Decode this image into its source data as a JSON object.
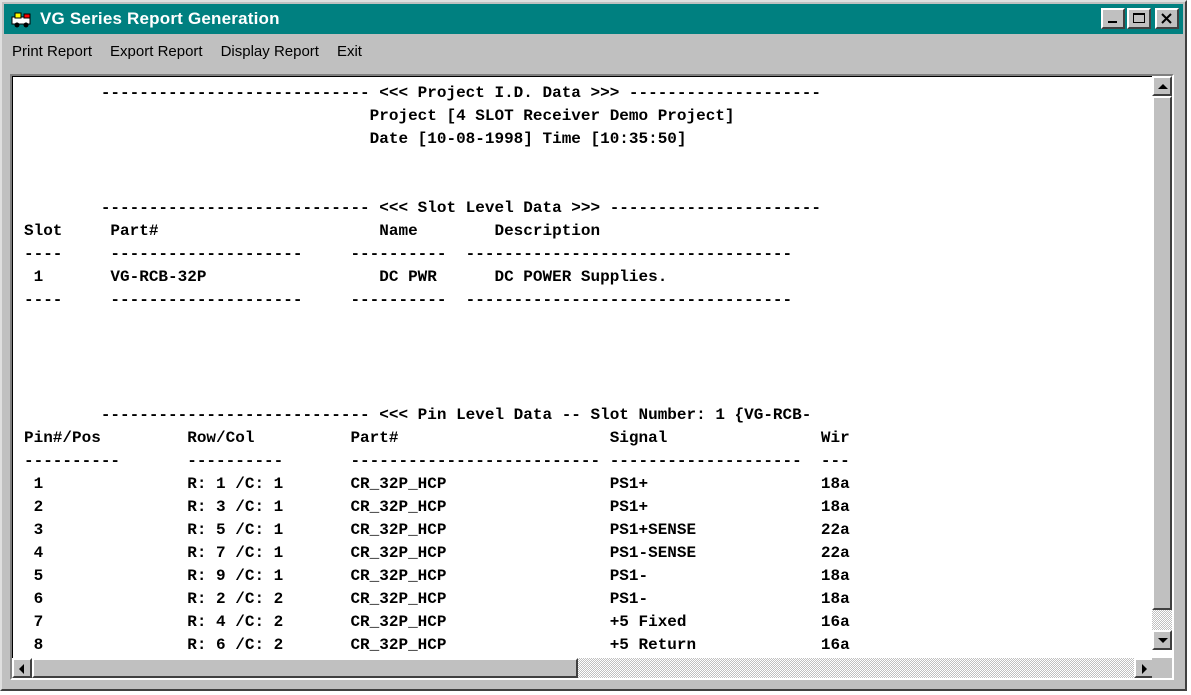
{
  "window": {
    "title": "VG Series Report Generation",
    "controls": [
      "minimize-icon",
      "maximize-icon",
      "close-icon"
    ]
  },
  "menu": [
    {
      "label": "Print Report"
    },
    {
      "label": "Export Report"
    },
    {
      "label": "Display Report"
    },
    {
      "label": "Exit"
    }
  ],
  "report": {
    "lines": [
      "        ---------------------------- <<< Project I.D. Data >>> --------------------",
      "                                    Project [4 SLOT Receiver Demo Project]",
      "                                    Date [10-08-1998] Time [10:35:50]",
      "",
      "",
      "        ---------------------------- <<< Slot Level Data >>> ----------------------",
      "Slot     Part#                       Name        Description",
      "----     --------------------     ----------  ----------------------------------",
      " 1       VG-RCB-32P                  DC PWR      DC POWER Supplies.",
      "----     --------------------     ----------  ----------------------------------",
      "",
      "",
      "",
      "",
      "        ---------------------------- <<< Pin Level Data -- Slot Number: 1 {VG-RCB-",
      "Pin#/Pos         Row/Col          Part#                      Signal                Wir",
      "----------       ----------       -------------------------- --------------------  ---",
      " 1               R: 1 /C: 1       CR_32P_HCP                 PS1+                  18a",
      " 2               R: 3 /C: 1       CR_32P_HCP                 PS1+                  18a",
      " 3               R: 5 /C: 1       CR_32P_HCP                 PS1+SENSE             22a",
      " 4               R: 7 /C: 1       CR_32P_HCP                 PS1-SENSE             22a",
      " 5               R: 9 /C: 1       CR_32P_HCP                 PS1-                  18a",
      " 6               R: 2 /C: 2       CR_32P_HCP                 PS1-                  18a",
      " 7               R: 4 /C: 2       CR_32P_HCP                 +5 Fixed              16a",
      " 8               R: 6 /C: 2       CR_32P_HCP                 +5 Return             16a",
      "----------       ----------       -------------------------- --------------------  ---"
    ]
  },
  "scrollbars": {
    "vertical": {
      "position": 0.0
    },
    "horizontal": {
      "position": 0.0
    }
  },
  "colors": {
    "titlebar": "#008080",
    "face": "#c0c0c0",
    "text": "#000000"
  }
}
